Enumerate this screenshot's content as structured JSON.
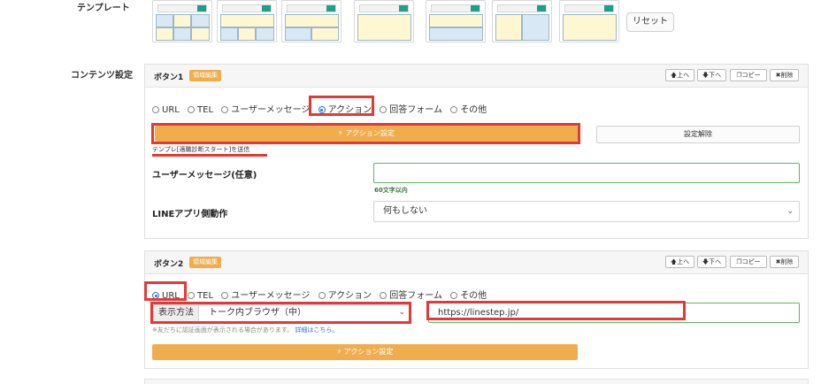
{
  "labels": {
    "template": "テンプレート",
    "content_settings": "コンテンツ設定"
  },
  "templates": {
    "reset_label": "リセット"
  },
  "toolbar": {
    "up": "上へ",
    "down": "下へ",
    "copy": "コピー",
    "delete": "削除"
  },
  "button1": {
    "title": "ボタン1",
    "badge": "領域編集",
    "radio_options": [
      "URL",
      "TEL",
      "ユーザーメッセージ",
      "アクション",
      "回答フォーム",
      "その他"
    ],
    "selected": "アクション",
    "action_button": "アクション設定",
    "clear_button": "設定解除",
    "action_desc": "テンプレ[適職診断スタート]を送信",
    "user_message_label": "ユーザーメッセージ(任意)",
    "user_message_value": "",
    "char_limit": "60文字以内",
    "line_app_label": "LINEアプリ側動作",
    "line_app_value": "何もしない"
  },
  "button2": {
    "title": "ボタン2",
    "badge": "領域編集",
    "radio_options": [
      "URL",
      "TEL",
      "ユーザーメッセージ",
      "アクション",
      "回答フォーム",
      "その他"
    ],
    "selected": "URL",
    "display_method_label": "表示方法",
    "display_method_value": "トーク内ブラウザ（中）",
    "url_value": "https://linestep.jp/",
    "note": "※友だちに認証画面が表示される場合があります。",
    "note_link": "詳細はこちら。",
    "action_button": "アクション設定"
  },
  "colors": {
    "accent": "#f0ad4e",
    "highlight": "#e53935",
    "radio": "#2f73d8",
    "valid": "#5cb85c"
  }
}
